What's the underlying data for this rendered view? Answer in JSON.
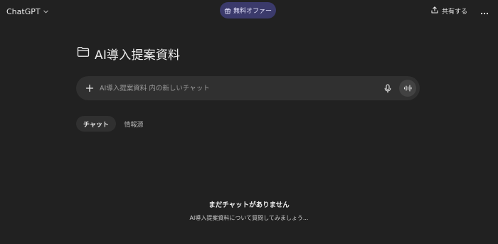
{
  "header": {
    "model_name": "ChatGPT",
    "model_chevron_icon": "chevron-down-icon",
    "offer_label": "無料オファー",
    "offer_icon": "gift-icon",
    "share_label": "共有する",
    "share_icon": "share-icon",
    "more_icon": "ellipsis-icon"
  },
  "project": {
    "title": "AI導入提案資料",
    "icon": "folder-icon"
  },
  "composer": {
    "placeholder": "AI導入提案資料 内の新しいチャット",
    "value": "",
    "plus_icon": "plus-icon",
    "mic_icon": "mic-icon",
    "voice_icon": "voice-mode-icon"
  },
  "tabs": [
    {
      "label": "チャット",
      "selected": true
    },
    {
      "label": "情報源",
      "selected": false
    }
  ],
  "empty_state": {
    "title": "まだチャットがありません",
    "subtitle": "AI導入提案資料について質問してみましょう..."
  },
  "colors": {
    "background": "#212121",
    "surface": "#303030",
    "offer_button": "#3b3a6b",
    "text": "#ececec",
    "muted_text": "#9b9b9b"
  }
}
